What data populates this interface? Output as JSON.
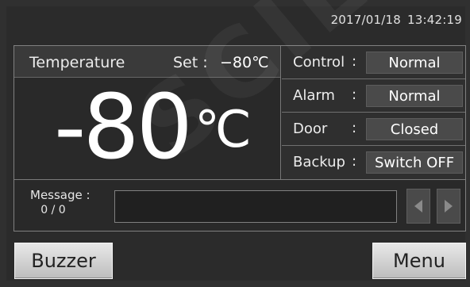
{
  "header": {
    "date": "2017/01/18",
    "time": "13:42:19"
  },
  "temperature": {
    "title": "Temperature",
    "set_label": "Set :",
    "set_value": "−80℃",
    "current_value": "-80",
    "unit": "℃"
  },
  "status": [
    {
      "label": "Control",
      "colon": ":",
      "value": "Normal"
    },
    {
      "label": "Alarm",
      "colon": ":",
      "value": "Normal"
    },
    {
      "label": "Door",
      "colon": ":",
      "value": "Closed"
    },
    {
      "label": "Backup",
      "colon": ":",
      "value": "Switch OFF"
    }
  ],
  "message": {
    "label": "Message :",
    "count": "0 / 0",
    "text": ""
  },
  "buttons": {
    "buzzer": "Buzzer",
    "menu": "Menu"
  },
  "watermark": "SCIE",
  "icons": {
    "prev": "triangle-left-icon",
    "next": "triangle-right-icon"
  }
}
